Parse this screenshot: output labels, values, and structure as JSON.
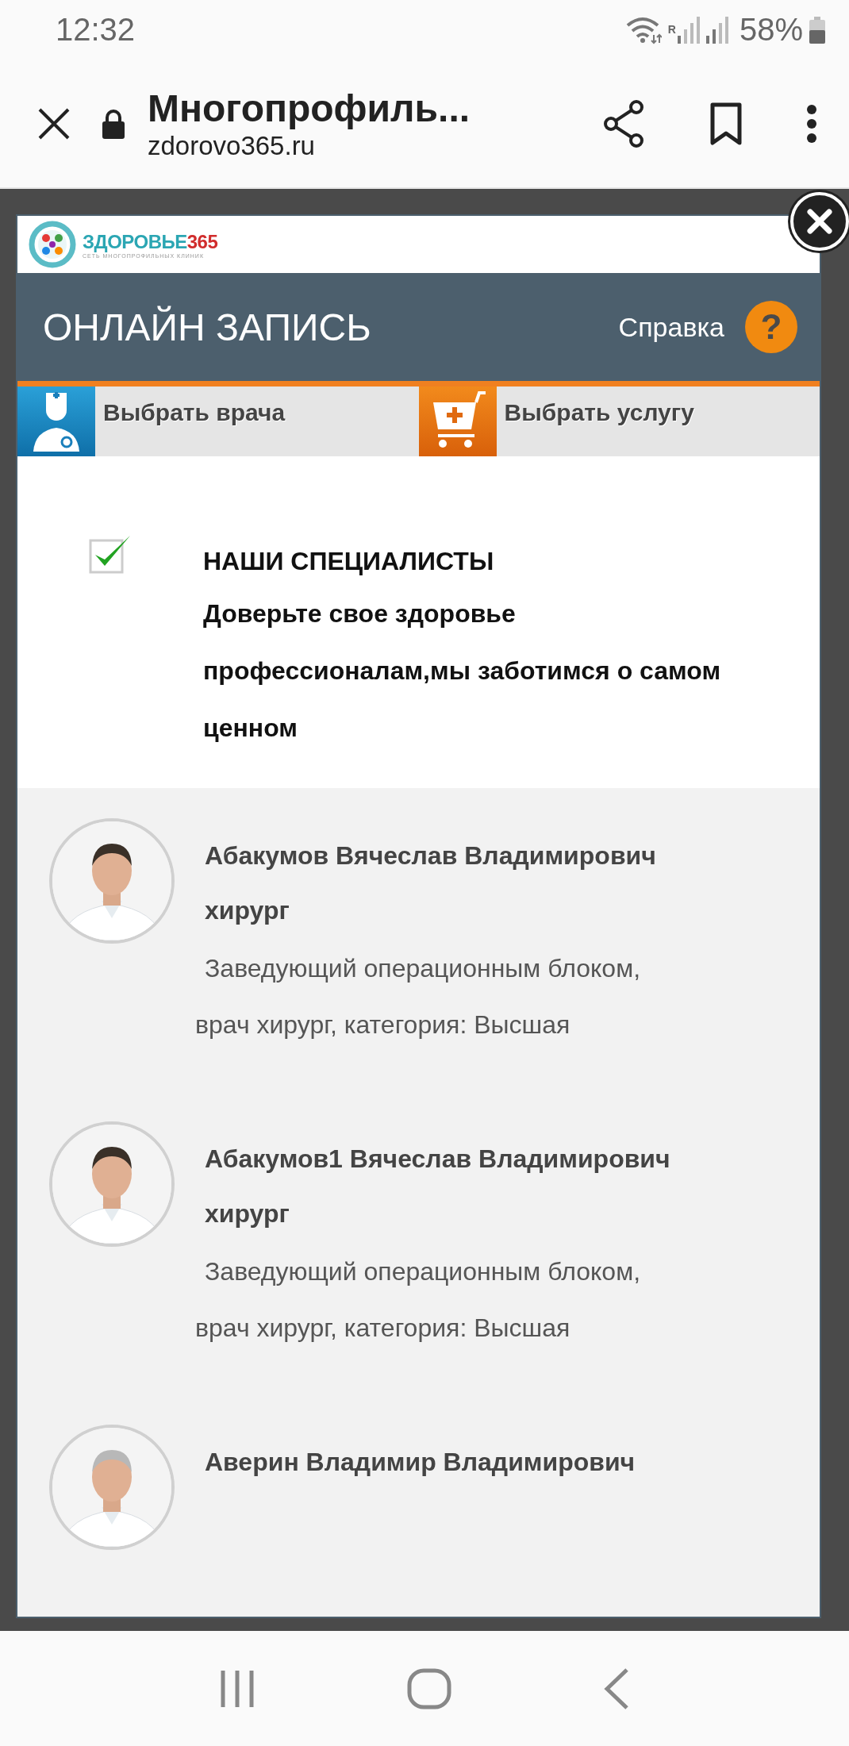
{
  "status_bar": {
    "time": "12:32",
    "roaming_mark": "R",
    "battery": "58%"
  },
  "browser": {
    "title": "Многопрофиль...",
    "url": "zdorovo365.ru"
  },
  "logo": {
    "brand": "ЗДОРОВЬЕ",
    "brand_number": "365",
    "tagline": "СЕТЬ МНОГОПРОФИЛЬНЫХ КЛИНИК"
  },
  "header": {
    "title": "ОНЛАЙН ЗАПИСЬ",
    "help_label": "Справка",
    "help_icon": "?"
  },
  "tabs": [
    {
      "kind": "doctor",
      "label": "Выбрать врача"
    },
    {
      "kind": "service",
      "label": "Выбрать услугу"
    }
  ],
  "intro": {
    "checked": true,
    "heading": "НАШИ СПЕЦИАЛИСТЫ",
    "text": "Доверьте свое здоровье профессионалам,мы заботимся о самом ценном"
  },
  "doctors": [
    {
      "name": "Абакумов Вячеслав Владимирович",
      "specialty": "хирург",
      "description": "Заведующий операционным блоком, врач хирург, категория: Высшая"
    },
    {
      "name": "Абакумов1 Вячеслав Владимирович",
      "specialty": "хирург",
      "description": "Заведующий операционным блоком, врач хирург, категория: Высшая"
    },
    {
      "name": "Аверин Владимир Владимирович"
    }
  ]
}
